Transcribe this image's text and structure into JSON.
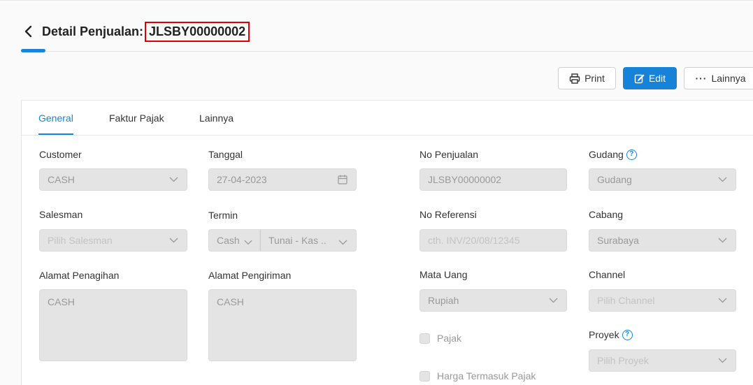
{
  "header": {
    "title": "Detail Penjualan:",
    "doc_id": "JLSBY00000002"
  },
  "actions": {
    "print": "Print",
    "edit": "Edit",
    "more": "Lainnya"
  },
  "tabs": [
    {
      "label": "General",
      "active": true
    },
    {
      "label": "Faktur Pajak",
      "active": false
    },
    {
      "label": "Lainnya",
      "active": false
    }
  ],
  "form": {
    "customer": {
      "label": "Customer",
      "value": "CASH"
    },
    "tanggal": {
      "label": "Tanggal",
      "value": "27-04-2023"
    },
    "no_penjualan": {
      "label": "No Penjualan",
      "value": "JLSBY00000002"
    },
    "gudang": {
      "label": "Gudang",
      "value": "Gudang"
    },
    "salesman": {
      "label": "Salesman",
      "placeholder": "Pilih Salesman"
    },
    "termin": {
      "label": "Termin",
      "value_type": "Cash",
      "value_account": "Tunai - Kas .."
    },
    "no_referensi": {
      "label": "No Referensi",
      "placeholder": "cth. INV/20/08/12345"
    },
    "cabang": {
      "label": "Cabang",
      "value": "Surabaya"
    },
    "alamat_penagihan": {
      "label": "Alamat Penagihan",
      "value": "CASH"
    },
    "alamat_pengiriman": {
      "label": "Alamat Pengiriman",
      "value": "CASH"
    },
    "mata_uang": {
      "label": "Mata Uang",
      "value": "Rupiah"
    },
    "channel": {
      "label": "Channel",
      "placeholder": "Pilih Channel"
    },
    "pajak": {
      "label": "Pajak",
      "checked": false
    },
    "proyek": {
      "label": "Proyek",
      "placeholder": "Pilih Proyek"
    },
    "harga_termasuk_pajak": {
      "label": "Harga Termasuk Pajak",
      "checked": false
    }
  },
  "colors": {
    "accent": "#1683d8",
    "highlight_border": "#e00000",
    "field_bg": "#e4e4e4"
  }
}
